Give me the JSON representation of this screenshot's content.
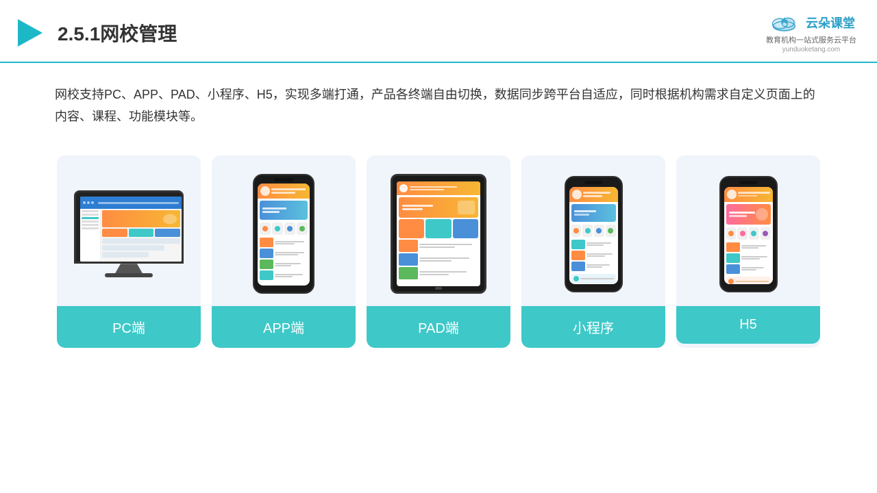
{
  "header": {
    "title": "2.5.1网校管理",
    "logo_text": "云朵课堂",
    "logo_url": "yunduoketang.com",
    "logo_tagline": "教育机构一站\n式服务云平台"
  },
  "description": "网校支持PC、APP、PAD、小程序、H5，实现多端打通，产品各终端自由切换，数据同步跨平台自适应，同时根据机构需求自定义页面上的内容、课程、功能模块等。",
  "cards": [
    {
      "id": "pc",
      "label": "PC端"
    },
    {
      "id": "app",
      "label": "APP端"
    },
    {
      "id": "pad",
      "label": "PAD端"
    },
    {
      "id": "mini",
      "label": "小程序"
    },
    {
      "id": "h5",
      "label": "H5"
    }
  ]
}
